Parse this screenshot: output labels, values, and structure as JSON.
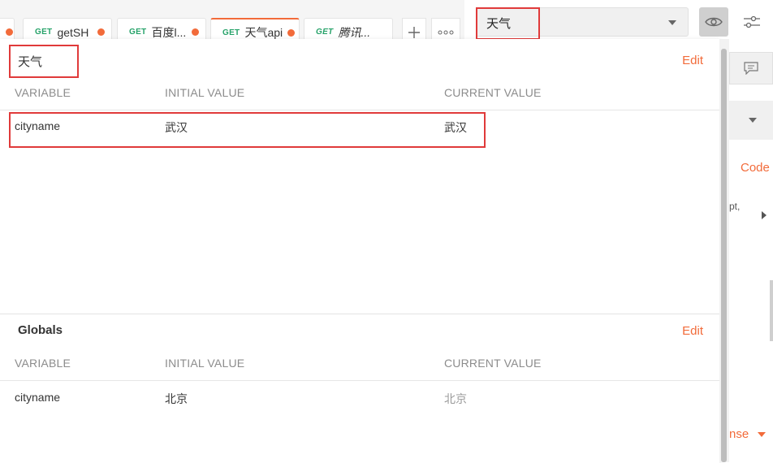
{
  "tabs": [
    {
      "method": "",
      "name": "...",
      "dirty": true
    },
    {
      "method": "GET",
      "name": "getSH",
      "dirty": true
    },
    {
      "method": "GET",
      "name": "百度l...",
      "dirty": true
    },
    {
      "method": "GET",
      "name": "天气api",
      "dirty": true,
      "active": true
    },
    {
      "method": "GET",
      "name": "腾讯...",
      "dirty": false,
      "italic": true
    }
  ],
  "tab_actions": {
    "new_tab": "+",
    "more": "∘∘∘"
  },
  "environment_selector": {
    "selected": "天气"
  },
  "environment_section": {
    "title": "天气",
    "edit_label": "Edit",
    "columns": [
      "VARIABLE",
      "INITIAL VALUE",
      "CURRENT VALUE"
    ],
    "rows": [
      {
        "variable": "cityname",
        "initial": "武汉",
        "current": "武汉"
      }
    ]
  },
  "globals_section": {
    "title": "Globals",
    "edit_label": "Edit",
    "columns": [
      "VARIABLE",
      "INITIAL VALUE",
      "CURRENT VALUE"
    ],
    "rows": [
      {
        "variable": "cityname",
        "initial": "北京",
        "current": "北京"
      }
    ]
  },
  "background": {
    "code_link": "Code",
    "snippet": "pt,",
    "response_fragment": "nse"
  },
  "colors": {
    "accent": "#f26b3a",
    "method_get": "#26a269",
    "highlight": "#e03a3a"
  }
}
